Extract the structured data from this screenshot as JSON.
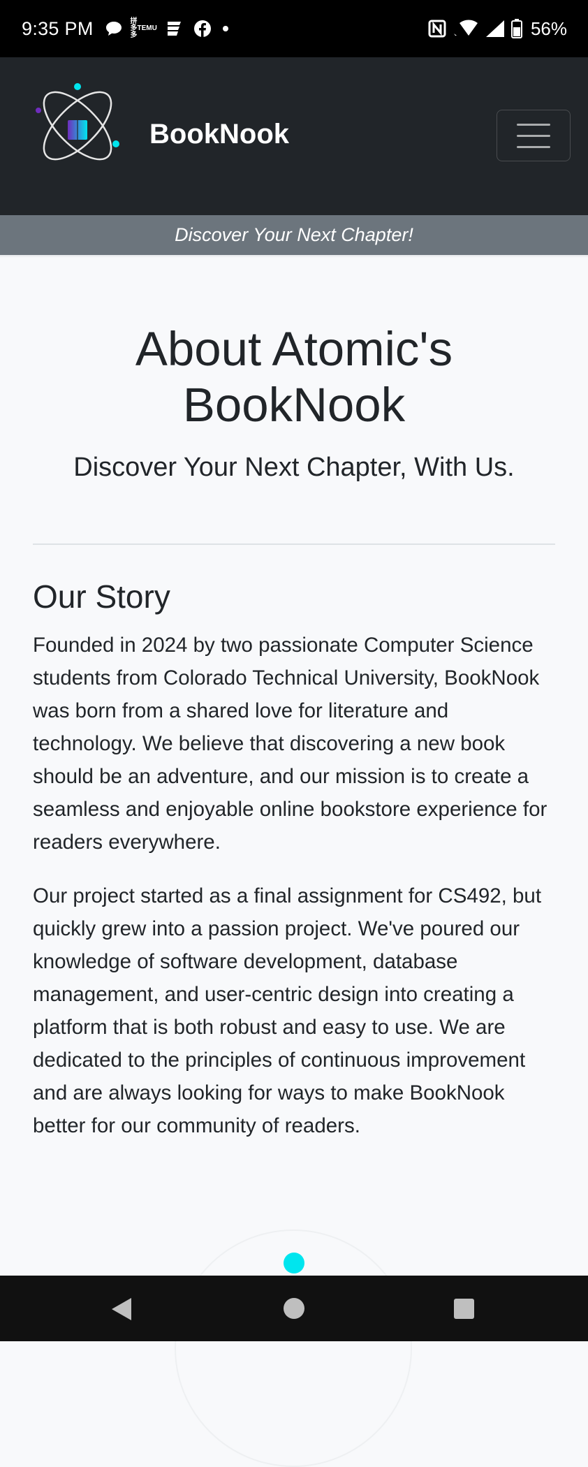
{
  "status_bar": {
    "time": "9:35 PM",
    "temu_label_top": "拼多多",
    "temu_label_bottom": "TEMU",
    "battery": "56%",
    "icons": [
      "chat-bubble-icon",
      "temu-icon",
      "news-icon",
      "facebook-icon",
      "dot-icon",
      "nfc-icon",
      "wifi-icon",
      "signal-icon",
      "battery-icon"
    ]
  },
  "navbar": {
    "brand": "BookNook",
    "logo_icon": "atom-book-logo",
    "menu_icon": "hamburger-menu-icon"
  },
  "tagline": "Discover Your Next Chapter!",
  "hero": {
    "title_line1": "About Atomic's",
    "title_line2": "BookNook",
    "subtitle": "Discover Your Next Chapter, With Us."
  },
  "story": {
    "heading": "Our Story",
    "paragraph1": "Founded in 2024 by two passionate Computer Science students from Colorado Technical University, BookNook was born from a shared love for literature and technology. We believe that discovering a new book should be an adventure, and our mission is to create a seamless and enjoyable online bookstore experience for readers everywhere.",
    "paragraph2": "Our project started as a final assignment for CS492, but quickly grew into a passion project. We've poured our knowledge of software development, database management, and user-centric design into creating a platform that is both robust and easy to use. We are dedicated to the principles of continuous improvement and are always looking for ways to make BookNook better for our community of readers."
  },
  "colors": {
    "navbar_bg": "#212529",
    "tagline_bg": "#6c757d",
    "page_bg": "#f8f9fb",
    "accent_cyan": "#00e5ee",
    "accent_purple": "#6f2dbd"
  },
  "system_nav": {
    "back_icon": "back-triangle-icon",
    "home_icon": "home-circle-icon",
    "recents_icon": "recents-square-icon"
  }
}
